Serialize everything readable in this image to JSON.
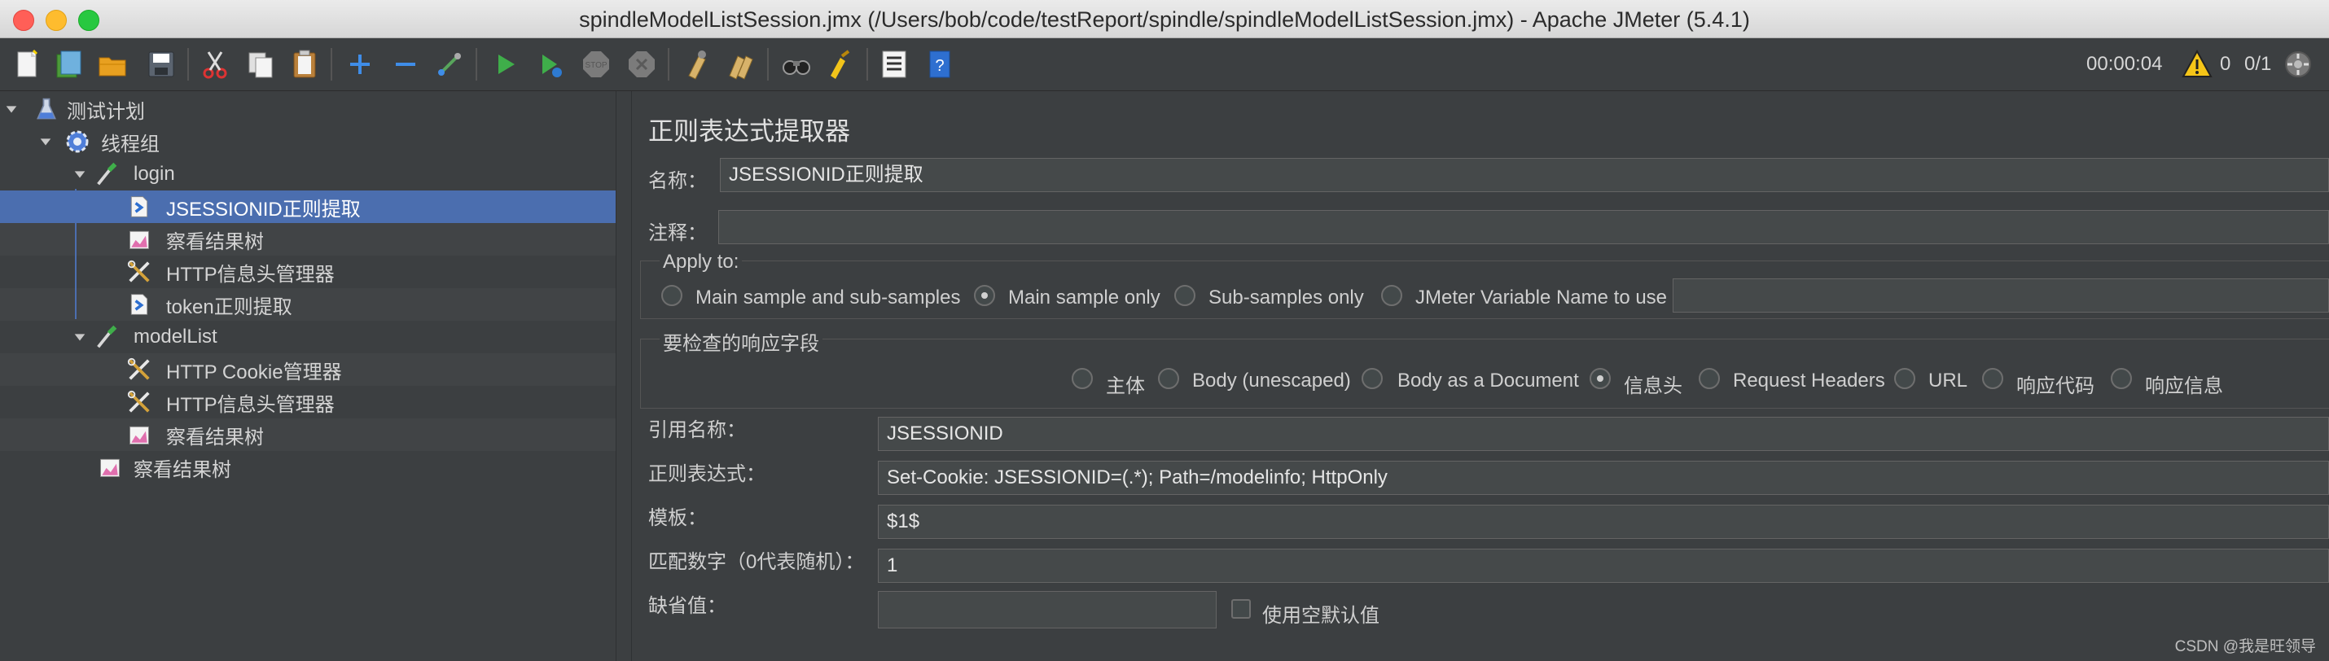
{
  "window": {
    "title": "spindleModelListSession.jmx (/Users/bob/code/testReport/spindle/spindleModelListSession.jmx) - Apache JMeter (5.4.1)"
  },
  "toolbar": {
    "buttons": [
      "new-icon",
      "templates-icon",
      "open-icon",
      "save-icon",
      "cut-icon",
      "copy-icon",
      "paste-icon",
      "expand-icon",
      "collapse-icon",
      "toggle-icon",
      "start-icon",
      "start-no-pause-icon",
      "stop-icon",
      "shutdown-icon",
      "clear-icon",
      "clear-all-icon",
      "search-icon",
      "reset-search-icon",
      "function-helper-icon",
      "help-icon"
    ],
    "elapsed_time": "00:00:04",
    "warning_count": "0",
    "threads": "0/1"
  },
  "tree": {
    "items": [
      {
        "label": "测试计划",
        "icon": "flask-icon"
      },
      {
        "label": "线程组",
        "icon": "gear-icon"
      },
      {
        "label": "login",
        "icon": "pipette-icon"
      },
      {
        "label": "JSESSIONID正则提取",
        "icon": "extractor-icon"
      },
      {
        "label": "察看结果树",
        "icon": "listener-icon"
      },
      {
        "label": "HTTP信息头管理器",
        "icon": "config-tools-icon"
      },
      {
        "label": "token正则提取",
        "icon": "extractor-icon"
      },
      {
        "label": "modelList",
        "icon": "pipette-icon"
      },
      {
        "label": "HTTP Cookie管理器",
        "icon": "config-tools-icon"
      },
      {
        "label": "HTTP信息头管理器",
        "icon": "config-tools-icon"
      },
      {
        "label": "察看结果树",
        "icon": "listener-icon"
      },
      {
        "label": "察看结果树",
        "icon": "listener-icon"
      }
    ]
  },
  "panel": {
    "heading": "正则表达式提取器",
    "name_label": "名称：",
    "name_value": "JSESSIONID正则提取",
    "comment_label": "注释：",
    "comment_value": "",
    "apply_to": {
      "title": "Apply to:",
      "options": [
        "Main sample and sub-samples",
        "Main sample only",
        "Sub-samples only",
        "JMeter Variable Name to use"
      ],
      "selected": "Main sample only",
      "variable_value": ""
    },
    "field_to_check": {
      "title": "要检查的响应字段",
      "options": [
        "主体",
        "Body (unescaped)",
        "Body as a Document",
        "信息头",
        "Request Headers",
        "URL",
        "响应代码",
        "响应信息"
      ],
      "selected": "信息头"
    },
    "ref_name_label": "引用名称：",
    "ref_name_value": "JSESSIONID",
    "regex_label": "正则表达式：",
    "regex_value": "Set-Cookie: JSESSIONID=(.*); Path=/modelinfo; HttpOnly",
    "template_label": "模板：",
    "template_value": "$1$",
    "match_no_label": "匹配数字（0代表随机）：",
    "match_no_value": "1",
    "default_label": "缺省值：",
    "default_value": "",
    "use_empty_default_label": "使用空默认值"
  },
  "watermark": "CSDN @我是旺领导"
}
